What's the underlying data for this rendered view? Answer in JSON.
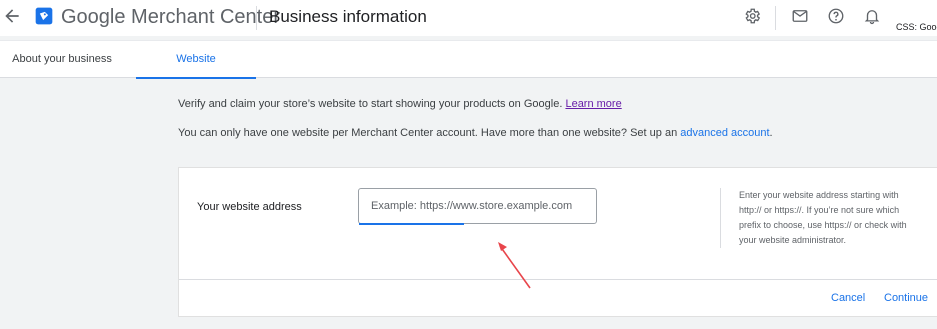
{
  "header": {
    "brand": "Google Merchant Center",
    "page_title": "Business information",
    "account_label": "CSS: Goog",
    "icons": [
      "back-arrow-icon",
      "merchant-center-logo",
      "settings-icon",
      "mail-icon",
      "help-icon",
      "notifications-icon"
    ]
  },
  "tabs": [
    {
      "label": "About your business",
      "active": false
    },
    {
      "label": "Website",
      "active": true
    }
  ],
  "main": {
    "intro_text": "Verify and claim your store’s website to start showing your products on Google.",
    "learn_more": "Learn more",
    "limit_text": "You can only have one website per Merchant Center account. Have more than one website? Set up an",
    "advanced_link": "advanced account",
    "period": "."
  },
  "form": {
    "field_label": "Your website address",
    "input_value": "",
    "input_placeholder": "Example: https://www.store.example.com",
    "help_text": "Enter your website address starting with http:// or https://. If you’re not sure which prefix to choose, use https:// or check with your website administrator.",
    "cancel_label": "Cancel",
    "continue_label": "Continue"
  },
  "colors": {
    "accent": "#1a73e8",
    "visited_link": "#681da8",
    "annotation_arrow": "#e8454b",
    "background": "#f1f3f4"
  }
}
